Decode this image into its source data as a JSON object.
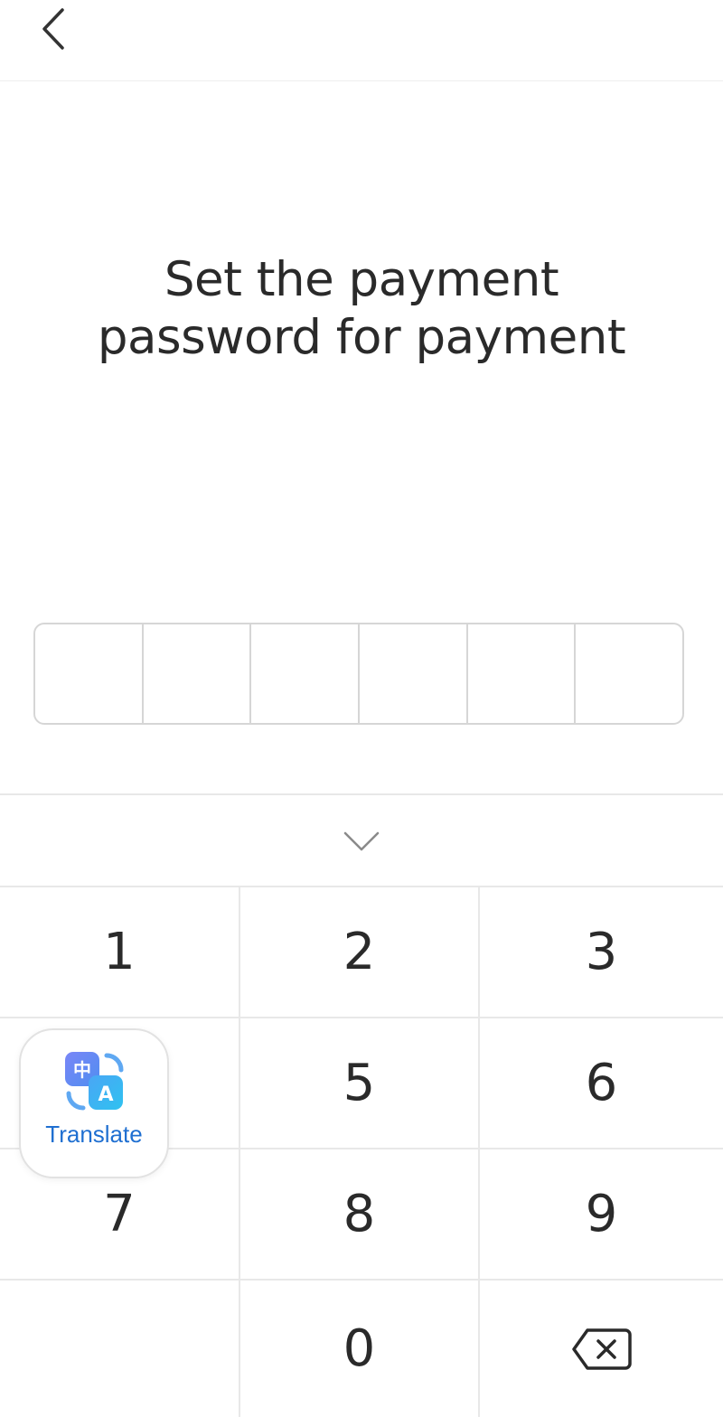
{
  "header": {
    "back_icon": "chevron-left-icon"
  },
  "title": {
    "line1": "Set the payment",
    "line2": "password for payment"
  },
  "pin": {
    "length": 6,
    "entered": 0
  },
  "keyboard": {
    "collapse_icon": "chevron-down-icon",
    "keys": [
      "1",
      "2",
      "3",
      "",
      "5",
      "6",
      "7",
      "8",
      "9",
      "",
      "0",
      ""
    ],
    "backspace_icon": "backspace-icon"
  },
  "translate_fab": {
    "label": "Translate",
    "icon_char_top": "中",
    "icon_char_bottom": "A",
    "colors": {
      "label": "#1f6fd1",
      "icon_gradient_start": "#6a7cf5",
      "icon_gradient_end": "#3fb6f2"
    }
  }
}
